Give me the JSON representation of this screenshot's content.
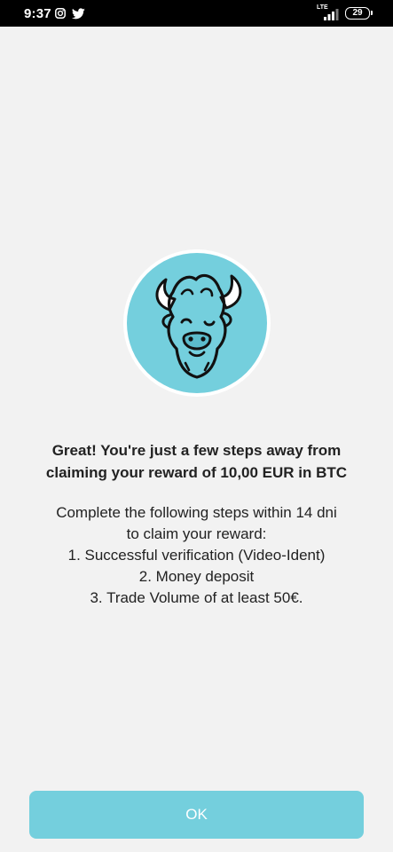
{
  "status_bar": {
    "time": "9:37",
    "network": "LTE",
    "battery": "29",
    "icons": [
      "instagram-icon",
      "twitter-icon",
      "signal-icon",
      "battery-icon"
    ]
  },
  "logo": {
    "icon": "bison-logo-icon",
    "background_color": "#74cfdd"
  },
  "headline": {
    "line1": "Great! You're just a few steps away from",
    "line2": "claiming your reward of 10,00 EUR in BTC"
  },
  "steps": {
    "intro_line1": "Complete the following steps within 14 dni",
    "intro_line2": "to claim your reward:",
    "items": [
      "1. Successful verification (Video-Ident)",
      "2. Money deposit",
      "3. Trade Volume of at least 50€."
    ]
  },
  "ok_button": {
    "label": "OK",
    "color": "#74cfdd"
  }
}
